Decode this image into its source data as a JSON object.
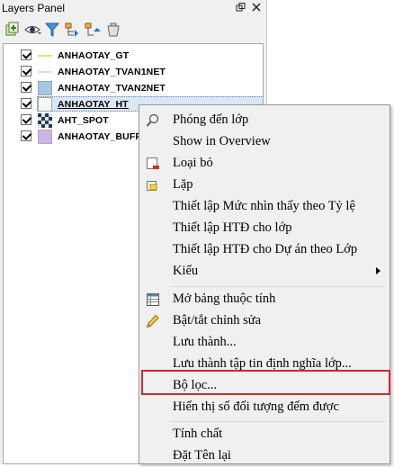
{
  "panel": {
    "title": "Layers Panel",
    "restore_glyph": "🗗",
    "close_glyph": "✕"
  },
  "toolbar": {
    "tools": [
      {
        "name": "add-group-icon"
      },
      {
        "name": "visibility-eye-icon"
      },
      {
        "name": "filter-icon"
      },
      {
        "name": "expand-all-icon"
      },
      {
        "name": "collapse-all-icon"
      },
      {
        "name": "remove-layer-icon"
      }
    ]
  },
  "layers": [
    {
      "name": "ANHAOTAY_GT",
      "checked": true,
      "symbol": "line-yellow",
      "color": "#f1d97c"
    },
    {
      "name": "ANHAOTAY_TVAN1NET",
      "checked": true,
      "symbol": "line-blue",
      "color": "#a7c3e6"
    },
    {
      "name": "ANHAOTAY_TVAN2NET",
      "checked": true,
      "symbol": "fill-blue",
      "color": "#a9c4e3"
    },
    {
      "name": "ANHAOTAY_HT",
      "checked": true,
      "symbol": "fill-white",
      "color": "#f7f7f7",
      "selected": true
    },
    {
      "name": "AHT_SPOT",
      "checked": true,
      "symbol": "checker",
      "color": "#2a3a52"
    },
    {
      "name": "ANHAOTAY_BUFF",
      "checked": true,
      "symbol": "fill-purple",
      "color": "#c9b7e2"
    }
  ],
  "menu": {
    "items": [
      {
        "label": "Phóng đến lớp",
        "icon": "zoom-to-layer-icon"
      },
      {
        "label": "Show in Overview",
        "icon": ""
      },
      {
        "label": "Loại bỏ",
        "icon": "remove-icon"
      },
      {
        "label": "Lặp",
        "icon": "duplicate-icon"
      },
      {
        "label": "Thiết lập Mức nhìn thấy theo Tỷ lệ",
        "icon": ""
      },
      {
        "label": "Thiết lập HTĐ cho lớp",
        "icon": ""
      },
      {
        "label": "Thiết lập HTĐ cho Dự án theo Lớp",
        "icon": ""
      },
      {
        "label": "Kiểu",
        "icon": "",
        "submenu": true
      },
      {
        "label": "Mở bảng thuộc tính",
        "icon": "attribute-table-icon"
      },
      {
        "label": "Bật/tắt chỉnh sửa",
        "icon": "pencil-icon"
      },
      {
        "label": "Lưu thành...",
        "icon": ""
      },
      {
        "label": "Lưu thành tập tin định nghĩa lớp...",
        "icon": ""
      },
      {
        "label": "Bộ lọc...",
        "icon": "",
        "highlighted": true
      },
      {
        "label": "Hiển thị số đối tượng đếm được",
        "icon": ""
      },
      {
        "label": "Tính chất",
        "icon": ""
      },
      {
        "label": "Đặt Tên lại",
        "icon": ""
      }
    ]
  },
  "colors": {
    "highlight_border": "#d0282f",
    "selection_fill": "#dbe7f5"
  }
}
